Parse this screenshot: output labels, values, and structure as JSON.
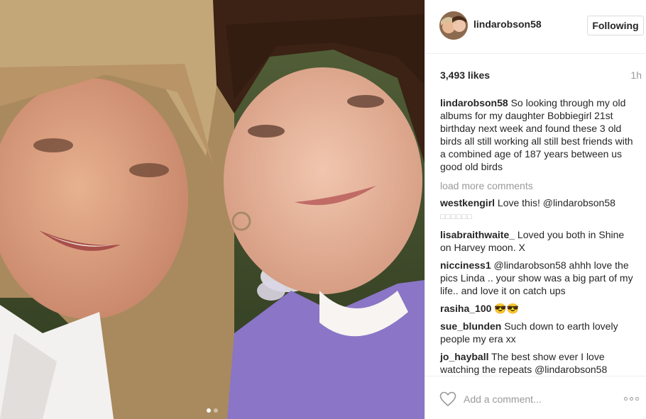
{
  "post": {
    "username": "lindarobson58",
    "follow_label": "Following",
    "likes": "3,493 likes",
    "time": "1h",
    "caption_user": "lindarobson58",
    "caption_text": " So looking through my old albums for my daughter Bobbiegirl 21st birthday next week and found these 3 old birds all still working all still best friends with a combined age of 187 years between us good old birds",
    "load_more": "load more comments",
    "comments": [
      {
        "user": "westkengirl",
        "text": " Love this! @lindarobson58",
        "extra": "□□□□□□"
      },
      {
        "user": "lisabraithwaite_",
        "text": " Loved you both in Shine on Harvey moon. X"
      },
      {
        "user": "nicciness1",
        "text": " @lindarobson58 ahhh love the pics Linda .. your show was a big part of my life.. and love it on catch ups"
      },
      {
        "user": "rasiha_100",
        "text": " 😎😎"
      },
      {
        "user": "sue_blunden",
        "text": " Such down to earth lovely people my era xx"
      },
      {
        "user": "jo_hayball",
        "text": " The best show ever I love watching the repeats @lindarobson58"
      }
    ],
    "add_comment_placeholder": "Add a comment...",
    "carousel": {
      "count": 2,
      "active": 0
    }
  },
  "icons": {
    "like": "heart-icon",
    "more": "more-options-icon"
  }
}
